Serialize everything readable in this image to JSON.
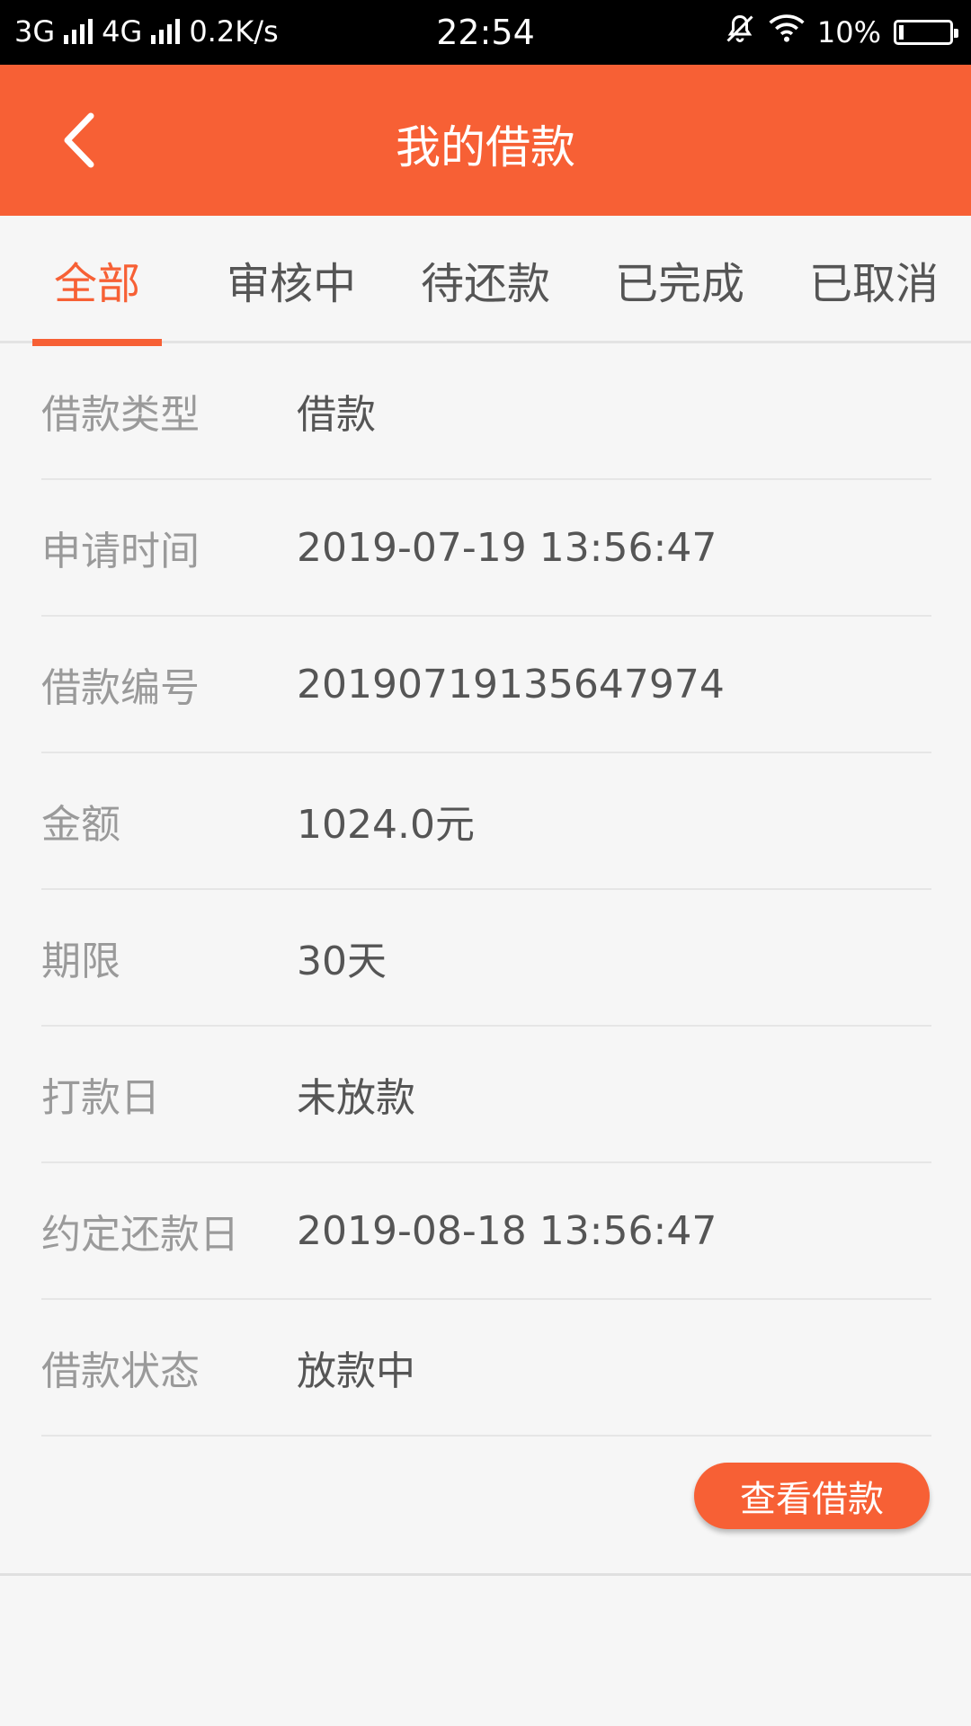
{
  "status_bar": {
    "net1": "3G",
    "net2": "4G",
    "speed": "0.2K/s",
    "time": "22:54",
    "battery": "10%",
    "battery_level": 0.1,
    "icons": [
      "signal-icon",
      "mute-bell-icon",
      "wifi-icon",
      "battery-icon"
    ]
  },
  "header": {
    "title": "我的借款",
    "back_icon": "chevron-left-icon"
  },
  "tabs": [
    {
      "label": "全部",
      "active": true
    },
    {
      "label": "审核中",
      "active": false
    },
    {
      "label": "待还款",
      "active": false
    },
    {
      "label": "已完成",
      "active": false
    },
    {
      "label": "已取消",
      "active": false
    }
  ],
  "loan": {
    "rows": [
      {
        "label": "借款类型",
        "value": "借款"
      },
      {
        "label": "申请时间",
        "value": "2019-07-19 13:56:47"
      },
      {
        "label": "借款编号",
        "value": "20190719135647974"
      },
      {
        "label": "金额",
        "value": "1024.0元"
      },
      {
        "label": "期限",
        "value": "30天"
      },
      {
        "label": "打款日",
        "value": "未放款"
      },
      {
        "label": "约定还款日",
        "value": "2019-08-18 13:56:47"
      },
      {
        "label": "借款状态",
        "value": "放款中"
      }
    ],
    "view_button": "查看借款"
  },
  "colors": {
    "accent": "#f76035",
    "label_text": "#9a9a9a",
    "value_text": "#555555"
  }
}
